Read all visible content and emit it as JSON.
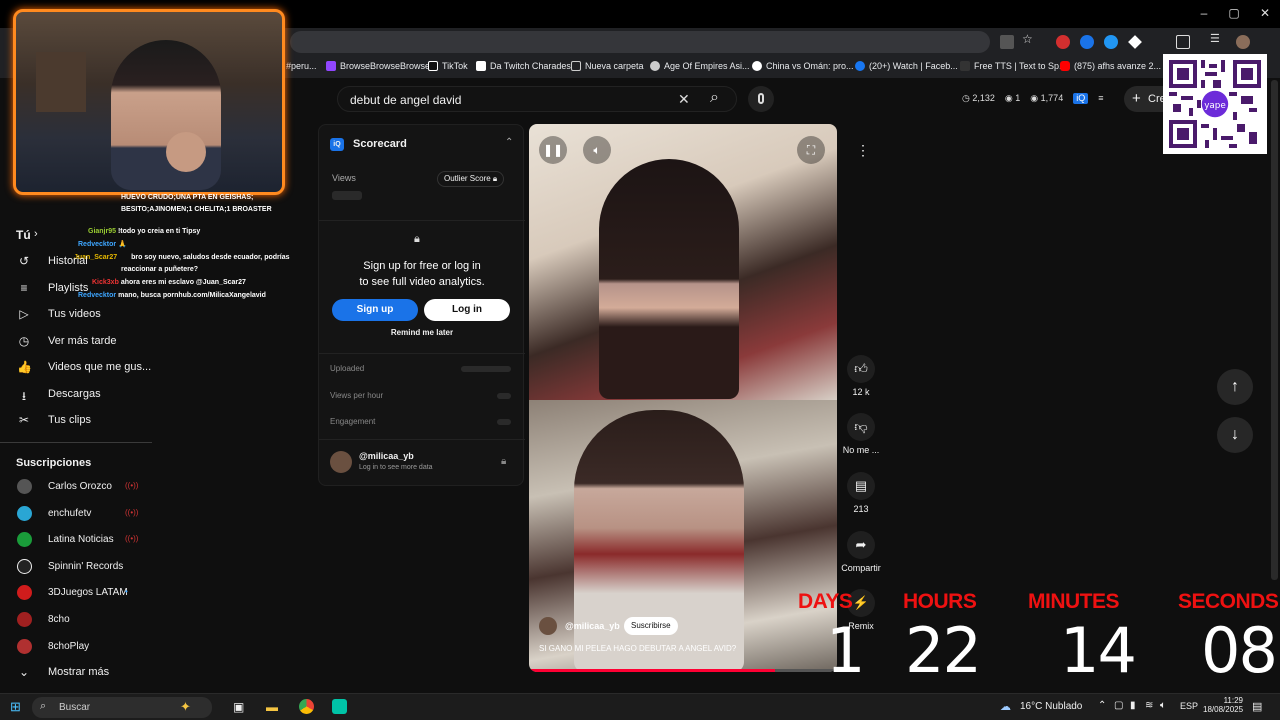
{
  "window": {
    "minimize": "–",
    "restore": "▢",
    "close": "✕"
  },
  "bookmarks": [
    {
      "label": "#peru...",
      "color": "#e8eaed"
    },
    {
      "label": "BrowseBrowseBrowse",
      "color": "#9146ff"
    },
    {
      "label": "TikTok",
      "color": "#ffffff"
    },
    {
      "label": "Da Twitch Charades",
      "color": "#ffffff"
    },
    {
      "label": "Nueva carpeta",
      "color": "#e8eaed"
    },
    {
      "label": "Age Of Empires Asi...",
      "color": "#e8eaed"
    },
    {
      "label": "China vs Omán: pro...",
      "color": "#ffffff"
    },
    {
      "label": "(20+) Watch | Faceb...",
      "color": "#1877f2"
    },
    {
      "label": "Free TTS | Text to Sp...",
      "color": "#e8eaed"
    },
    {
      "label": "(875) afhs avanze 2...",
      "color": "#ff0000"
    }
  ],
  "search": {
    "query": "debut de angel david",
    "clear_icon": "✕",
    "search_icon": "⌕",
    "mic_icon": "🎙"
  },
  "stats": {
    "views": "2,132",
    "one": "1",
    "count": "1,774"
  },
  "create": {
    "label": "Cre",
    "icon": "+"
  },
  "sidebar": {
    "tu_label": "Tú",
    "items": [
      {
        "label": "Historial",
        "icon": "↺"
      },
      {
        "label": "Playlists",
        "icon": "≡"
      },
      {
        "label": "Tus videos",
        "icon": "▷"
      },
      {
        "label": "Ver más tarde",
        "icon": "◷"
      },
      {
        "label": "Videos que me gus...",
        "icon": "👍"
      },
      {
        "label": "Descargas",
        "icon": "⭳"
      },
      {
        "label": "Tus clips",
        "icon": "✂"
      }
    ],
    "subs_title": "Suscripciones",
    "subscriptions": [
      {
        "label": "Carlos Orozco",
        "color": "#555",
        "live": "((•))"
      },
      {
        "label": "enchufetv",
        "color": "#2aa6d4",
        "live": "((•))"
      },
      {
        "label": "Latina Noticias",
        "color": "#1a9c3a",
        "live": "((•))"
      },
      {
        "label": "Spinnin' Records",
        "color": "#222",
        "live": ""
      },
      {
        "label": "3DJuegos LATAM",
        "color": "#d01c1c",
        "live": "•"
      },
      {
        "label": "8cho",
        "color": "#a02020",
        "live": ""
      },
      {
        "label": "8choPlay",
        "color": "#b03030",
        "live": ""
      }
    ],
    "more": "Mostrar más"
  },
  "chat": [
    {
      "name": "",
      "text": "HUEVO CRUDO;UNA PTA EN GEISHAS;"
    },
    {
      "name": "",
      "text": "BESITO;AJINOMEN;1 CHELITA;1 BROASTER"
    },
    {
      "name": "Gianjr95",
      "text": "!todo yo creia en ti Tipsy"
    },
    {
      "name": "Redvecktor",
      "text": "🙏"
    },
    {
      "name": "Juan_Scar27",
      "text": "bro soy nuevo, saludos desde ecuador, podrías"
    },
    {
      "name": "",
      "text": "reaccionar a puñetere?"
    },
    {
      "name": "Kick3xb",
      "text": "ahora eres mi esclavo @Juan_Scar27"
    },
    {
      "name": "Redvecktor",
      "text": "mano, busca pornhub.com/MilicaXangelavid"
    }
  ],
  "scorecard": {
    "title": "Scorecard",
    "views_label": "Views",
    "outlier": "Outlier Score",
    "signup_text_1": "Sign up for free or log in",
    "signup_text_2": "to see full video analytics.",
    "signup_btn": "Sign up",
    "login_btn": "Log in",
    "remind": "Remind me later",
    "uploaded": "Uploaded",
    "views_per_hour": "Views per hour",
    "engagement": "Engagement",
    "channel": "@milicaa_yb",
    "channel_sub": "Log in to see more data"
  },
  "video": {
    "channel": "@milicaa_yb",
    "subscribe": "Suscribirse",
    "caption": "SI GANO MI PELEA HAGO DEBUTAR A ANGEL AVID?"
  },
  "actions": {
    "likes": "12 k",
    "dislike": "No me ...",
    "comments": "213",
    "share": "Compartir",
    "remix": "Remix"
  },
  "countdown": {
    "days_label": "DAYS",
    "days": "1",
    "hours_label": "HOURS",
    "hours": "22",
    "minutes_label": "MINUTES",
    "minutes": "14",
    "seconds_label": "SECONDS",
    "seconds": "08"
  },
  "taskbar": {
    "search": "Buscar",
    "weather": "16°C  Nublado",
    "lang": "ESP",
    "time": "11:29",
    "date": "18/08/2025"
  }
}
